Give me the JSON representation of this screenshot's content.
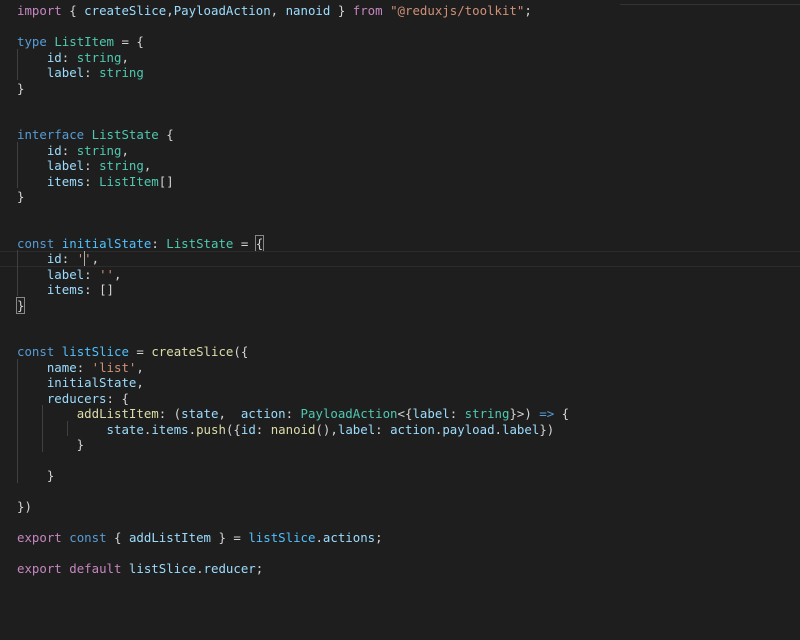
{
  "editor": {
    "language": "typescript",
    "theme": {
      "background": "#1e1e1e",
      "foreground": "#d4d4d4",
      "keyword_control": "#c586c0",
      "keyword_storage": "#569cd6",
      "function": "#dcdcaa",
      "variable": "#9cdcfe",
      "constant": "#4fc1ff",
      "type": "#4ec9b0",
      "string": "#ce9178"
    },
    "cursor": {
      "line": 17,
      "column": 15
    },
    "lines": [
      [
        [
          "import",
          "kw"
        ],
        [
          " { ",
          "p"
        ],
        [
          "createSlice",
          "v"
        ],
        [
          ",",
          "p"
        ],
        [
          "PayloadAction",
          "v"
        ],
        [
          ", ",
          "p"
        ],
        [
          "nanoid",
          "v"
        ],
        [
          " } ",
          "p"
        ],
        [
          "from",
          "kw"
        ],
        [
          " ",
          "p"
        ],
        [
          "\"@reduxjs/toolkit\"",
          "s"
        ],
        [
          ";",
          "p"
        ]
      ],
      [],
      [
        [
          "type",
          "st"
        ],
        [
          " ",
          "p"
        ],
        [
          "ListItem",
          "ty"
        ],
        [
          " = {",
          "p"
        ]
      ],
      [
        [
          "    ",
          "p"
        ],
        [
          "id",
          "v"
        ],
        [
          ": ",
          "p"
        ],
        [
          "string",
          "ty"
        ],
        [
          ",",
          "p"
        ]
      ],
      [
        [
          "    ",
          "p"
        ],
        [
          "label",
          "v"
        ],
        [
          ": ",
          "p"
        ],
        [
          "string",
          "ty"
        ]
      ],
      [
        [
          "}",
          "p"
        ]
      ],
      [],
      [],
      [
        [
          "interface",
          "st"
        ],
        [
          " ",
          "p"
        ],
        [
          "ListState",
          "ty"
        ],
        [
          " {",
          "p"
        ]
      ],
      [
        [
          "    ",
          "p"
        ],
        [
          "id",
          "v"
        ],
        [
          ": ",
          "p"
        ],
        [
          "string",
          "ty"
        ],
        [
          ",",
          "p"
        ]
      ],
      [
        [
          "    ",
          "p"
        ],
        [
          "label",
          "v"
        ],
        [
          ": ",
          "p"
        ],
        [
          "string",
          "ty"
        ],
        [
          ",",
          "p"
        ]
      ],
      [
        [
          "    ",
          "p"
        ],
        [
          "items",
          "v"
        ],
        [
          ": ",
          "p"
        ],
        [
          "ListItem",
          "ty"
        ],
        [
          "[]",
          "p"
        ]
      ],
      [
        [
          "}",
          "p"
        ]
      ],
      [],
      [],
      [
        [
          "const",
          "st"
        ],
        [
          " ",
          "p"
        ],
        [
          "initialState",
          "c"
        ],
        [
          ": ",
          "p"
        ],
        [
          "ListState",
          "ty"
        ],
        [
          " = ",
          "p"
        ],
        [
          "{",
          "p bm"
        ]
      ],
      [
        [
          "    ",
          "p"
        ],
        [
          "id",
          "v"
        ],
        [
          ": ",
          "p"
        ],
        [
          "''",
          "s"
        ],
        [
          ",",
          "p"
        ]
      ],
      [
        [
          "    ",
          "p"
        ],
        [
          "label",
          "v"
        ],
        [
          ": ",
          "p"
        ],
        [
          "''",
          "s"
        ],
        [
          ",",
          "p"
        ]
      ],
      [
        [
          "    ",
          "p"
        ],
        [
          "items",
          "v"
        ],
        [
          ": ",
          "p"
        ],
        [
          "[]",
          "p"
        ]
      ],
      [
        [
          "}",
          "p bm"
        ]
      ],
      [],
      [],
      [
        [
          "const",
          "st"
        ],
        [
          " ",
          "p"
        ],
        [
          "listSlice",
          "c"
        ],
        [
          " = ",
          "p"
        ],
        [
          "createSlice",
          "fn"
        ],
        [
          "({",
          "p"
        ]
      ],
      [
        [
          "    ",
          "p"
        ],
        [
          "name",
          "v"
        ],
        [
          ": ",
          "p"
        ],
        [
          "'list'",
          "s"
        ],
        [
          ",",
          "p"
        ]
      ],
      [
        [
          "    ",
          "p"
        ],
        [
          "initialState",
          "v"
        ],
        [
          ",",
          "p"
        ]
      ],
      [
        [
          "    ",
          "p"
        ],
        [
          "reducers",
          "v"
        ],
        [
          ": {",
          "p"
        ]
      ],
      [
        [
          "        ",
          "p"
        ],
        [
          "addListItem",
          "fn"
        ],
        [
          ": (",
          "p"
        ],
        [
          "state",
          "v"
        ],
        [
          ",  ",
          "p"
        ],
        [
          "action",
          "v"
        ],
        [
          ": ",
          "p"
        ],
        [
          "PayloadAction",
          "ty"
        ],
        [
          "<{",
          "p"
        ],
        [
          "label",
          "v"
        ],
        [
          ": ",
          "p"
        ],
        [
          "string",
          "ty"
        ],
        [
          "}>",
          "p"
        ],
        [
          ") ",
          "p"
        ],
        [
          "=>",
          "st"
        ],
        [
          " {",
          "p"
        ]
      ],
      [
        [
          "            ",
          "p"
        ],
        [
          "state",
          "v"
        ],
        [
          ".",
          "p"
        ],
        [
          "items",
          "v"
        ],
        [
          ".",
          "p"
        ],
        [
          "push",
          "fn"
        ],
        [
          "({",
          "p"
        ],
        [
          "id",
          "v"
        ],
        [
          ": ",
          "p"
        ],
        [
          "nanoid",
          "fn"
        ],
        [
          "(),",
          "p"
        ],
        [
          "label",
          "v"
        ],
        [
          ": ",
          "p"
        ],
        [
          "action",
          "v"
        ],
        [
          ".",
          "p"
        ],
        [
          "payload",
          "v"
        ],
        [
          ".",
          "p"
        ],
        [
          "label",
          "v"
        ],
        [
          "})",
          "p"
        ]
      ],
      [
        [
          "        }",
          "p"
        ]
      ],
      [],
      [
        [
          "    }",
          "p"
        ]
      ],
      [],
      [
        [
          "})",
          "p"
        ]
      ],
      [],
      [
        [
          "export",
          "kw"
        ],
        [
          " ",
          "p"
        ],
        [
          "const",
          "st"
        ],
        [
          " { ",
          "p"
        ],
        [
          "addListItem",
          "v"
        ],
        [
          " } = ",
          "p"
        ],
        [
          "listSlice",
          "c"
        ],
        [
          ".",
          "p"
        ],
        [
          "actions",
          "v"
        ],
        [
          ";",
          "p"
        ]
      ],
      [],
      [
        [
          "export",
          "kw"
        ],
        [
          " ",
          "p"
        ],
        [
          "default",
          "kw"
        ],
        [
          " ",
          "p"
        ],
        [
          "listSlice",
          "v"
        ],
        [
          ".",
          "p"
        ],
        [
          "reducer",
          "v"
        ],
        [
          ";",
          "p"
        ]
      ]
    ]
  }
}
